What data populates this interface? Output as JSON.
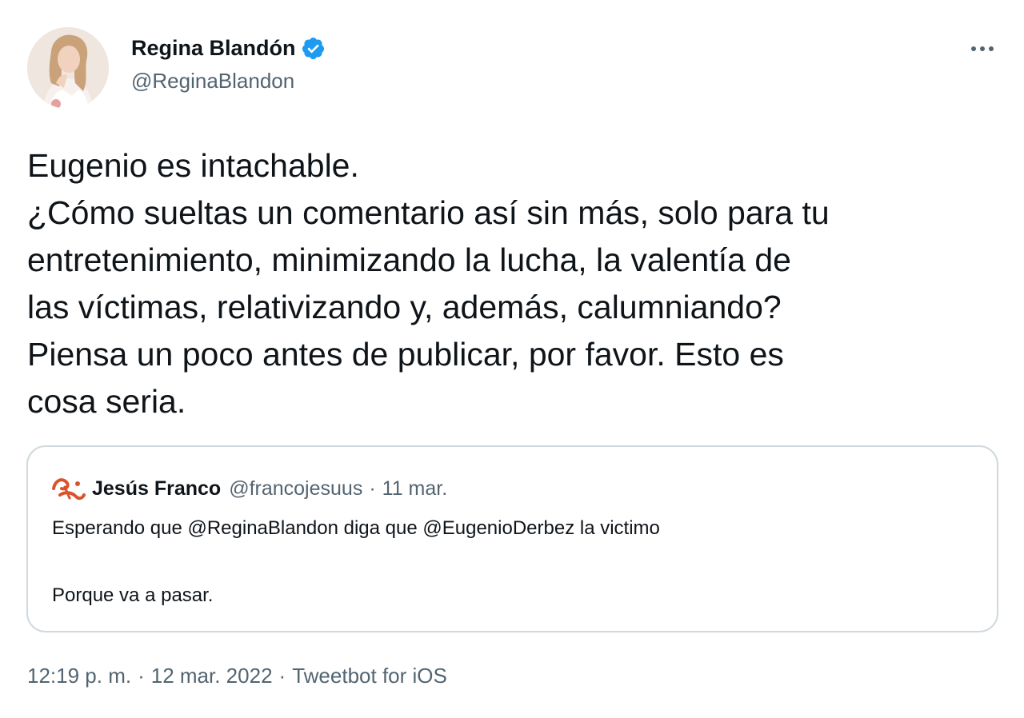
{
  "author": {
    "display_name": "Regina Blandón",
    "handle": "@ReginaBlandon",
    "verified": true
  },
  "tweet": {
    "lines": [
      "Eugenio es intachable.",
      "¿Cómo sueltas un comentario así sin más, solo para tu",
      "entretenimiento, minimizando la lucha, la valentía de",
      "las víctimas, relativizando y, además, calumniando?",
      "Piensa un poco antes de publicar, por favor. Esto es",
      "cosa seria."
    ]
  },
  "quoted": {
    "display_name": "Jesús Franco",
    "handle": "@francojesuus",
    "separator": "·",
    "date": "11 mar.",
    "line1": "Esperando que @ReginaBlandon diga que @EugenioDerbez la victimo",
    "line2": "Porque va a pasar."
  },
  "meta": {
    "time": "12:19 p. m.",
    "separator": "·",
    "date": "12 mar. 2022",
    "source": "Tweetbot for iOS"
  },
  "colors": {
    "text": "#0f1419",
    "secondary": "#536471",
    "verified": "#1d9bf0",
    "border": "#cfd9de"
  },
  "icons": {
    "verified": "verified-badge-icon",
    "more": "more-dots-icon"
  }
}
